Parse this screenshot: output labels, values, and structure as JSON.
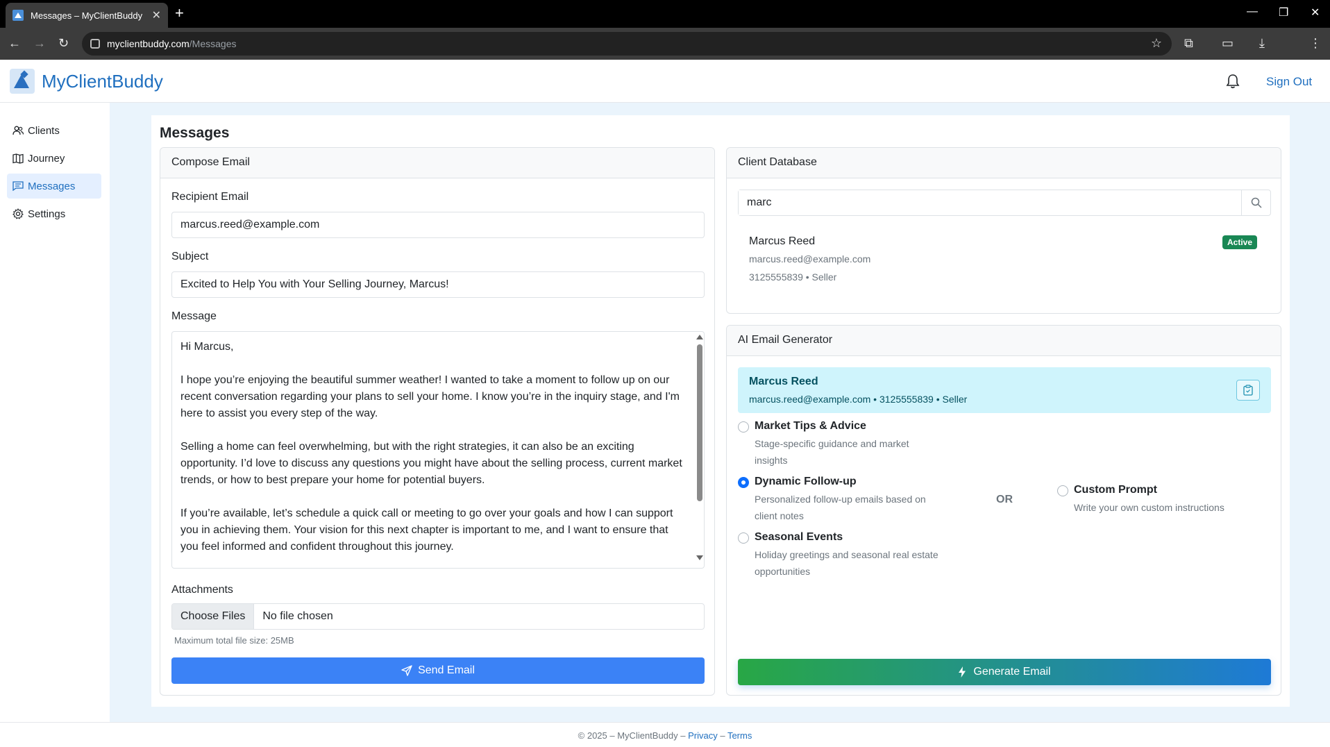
{
  "browser": {
    "tab_title": "Messages – MyClientBuddy",
    "url_host": "myclientbuddy.com",
    "url_path": "/Messages"
  },
  "header": {
    "brand": "MyClientBuddy",
    "sign_out": "Sign Out"
  },
  "sidebar": {
    "items": [
      {
        "label": "Clients",
        "icon": "users-icon"
      },
      {
        "label": "Journey",
        "icon": "map-icon"
      },
      {
        "label": "Messages",
        "icon": "message-icon",
        "active": true
      },
      {
        "label": "Settings",
        "icon": "gear-icon"
      }
    ]
  },
  "page": {
    "title": "Messages"
  },
  "compose": {
    "header": "Compose Email",
    "recipient_label": "Recipient Email",
    "recipient_value": "marcus.reed@example.com",
    "subject_label": "Subject",
    "subject_value": "Excited to Help You with Your Selling Journey, Marcus!",
    "message_label": "Message",
    "message_paragraphs": [
      "Hi Marcus,",
      "I hope you’re enjoying the beautiful summer weather! I wanted to take a moment to follow up on our recent conversation regarding your plans to sell your home. I know you’re in the inquiry stage, and I'm here to assist you every step of the way.",
      "Selling a home can feel overwhelming, but with the right strategies, it can also be an exciting opportunity. I’d love to discuss any questions you might have about the selling process, current market trends, or how to best prepare your home for potential buyers.",
      "If you’re available, let’s schedule a quick call or meeting to go over your goals and how I can support you in achieving them. Your vision for this next chapter is important to me, and I want to ensure that you feel informed and confident throughout this journey."
    ],
    "attachments_label": "Attachments",
    "choose_files": "Choose Files",
    "no_file": "No file chosen",
    "max_size_hint": "Maximum total file size: 25MB",
    "send_button": "Send Email"
  },
  "client_db": {
    "header": "Client Database",
    "search_value": "marc",
    "client": {
      "name": "Marcus Reed",
      "email": "marcus.reed@example.com",
      "meta": "3125555839 • Seller",
      "status": "Active"
    }
  },
  "ai_generator": {
    "header": "AI Email Generator",
    "client_name": "Marcus Reed",
    "client_info": "marcus.reed@example.com • 3125555839 • Seller",
    "options": [
      {
        "title": "Market Tips & Advice",
        "desc_lines": [
          "Stage-specific guidance and market",
          "insights"
        ],
        "checked": false
      },
      {
        "title": "Dynamic Follow-up",
        "desc_lines": [
          "Personalized follow-up emails based on",
          "client notes"
        ],
        "checked": true
      },
      {
        "title": "Seasonal Events",
        "desc_lines": [
          "Holiday greetings and seasonal real estate",
          "opportunities"
        ],
        "checked": false
      }
    ],
    "or_text": "OR",
    "custom": {
      "title": "Custom Prompt",
      "desc": "Write your own custom instructions",
      "checked": false
    },
    "generate_button": "Generate Email"
  },
  "footer": {
    "copyright": "© 2025 – MyClientBuddy – ",
    "privacy": "Privacy",
    "sep": " – ",
    "terms": "Terms"
  }
}
